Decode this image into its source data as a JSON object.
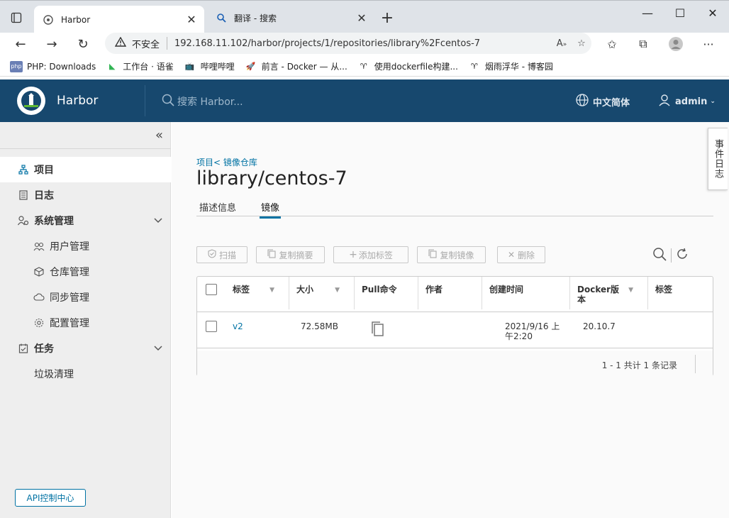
{
  "browser": {
    "tabs": [
      {
        "title": "Harbor",
        "active": true
      },
      {
        "title": "翻译 - 搜索",
        "active": false
      }
    ],
    "address": {
      "security_label": "不安全",
      "url": "192.168.11.102/harbor/projects/1/repositories/library%2Fcentos-7"
    },
    "bookmarks": [
      {
        "label": "PHP: Downloads",
        "icon": "php-icon"
      },
      {
        "label": "工作台 · 语雀",
        "icon": "yuque-icon"
      },
      {
        "label": "哔哩哔哩",
        "icon": "bilibili-icon"
      },
      {
        "label": "前言 - Docker — 从...",
        "icon": "rocket-icon"
      },
      {
        "label": "使用dockerfile构建...",
        "icon": "cnblogs-icon"
      },
      {
        "label": "烟雨浮华 - 博客园",
        "icon": "cnblogs-icon"
      }
    ]
  },
  "header": {
    "brand": "Harbor",
    "search_placeholder": "搜索 Harbor...",
    "language": "中文简体",
    "user": "admin"
  },
  "sidebar": {
    "items": [
      {
        "label": "项目",
        "icon": "project-icon",
        "active": true
      },
      {
        "label": "日志",
        "icon": "log-icon"
      },
      {
        "label": "系统管理",
        "icon": "admin-icon",
        "expandable": true
      },
      {
        "label": "用户管理",
        "icon": "users-icon",
        "sub": true
      },
      {
        "label": "仓库管理",
        "icon": "box-icon",
        "sub": true
      },
      {
        "label": "同步管理",
        "icon": "cloud-sync-icon",
        "sub": true
      },
      {
        "label": "配置管理",
        "icon": "gear-icon",
        "sub": true
      },
      {
        "label": "任务",
        "icon": "task-icon",
        "expandable": true
      },
      {
        "label": "垃圾清理",
        "sub": false
      }
    ],
    "api_button": "API控制中心"
  },
  "main": {
    "breadcrumb": "项目< 镜像仓库",
    "title": "library/centos-7",
    "tabs": [
      {
        "label": "描述信息",
        "active": false
      },
      {
        "label": "镜像",
        "active": true
      }
    ],
    "actions": {
      "scan": "扫描",
      "copy_digest": "复制摘要",
      "add_label": "添加标签",
      "copy_image": "复制镜像",
      "delete": "删除"
    },
    "table": {
      "columns": [
        "标签",
        "大小",
        "Pull命令",
        "作者",
        "创建时间",
        "Docker版本",
        "标签"
      ],
      "rows": [
        {
          "tag": "v2",
          "size": "72.58MB",
          "author": "",
          "created": "2021/9/16 上午2:20",
          "docker_version": "20.10.7",
          "labels": ""
        }
      ],
      "footer": "1 - 1 共计 1 条记录"
    }
  },
  "drawer": {
    "label": "事件日志"
  }
}
